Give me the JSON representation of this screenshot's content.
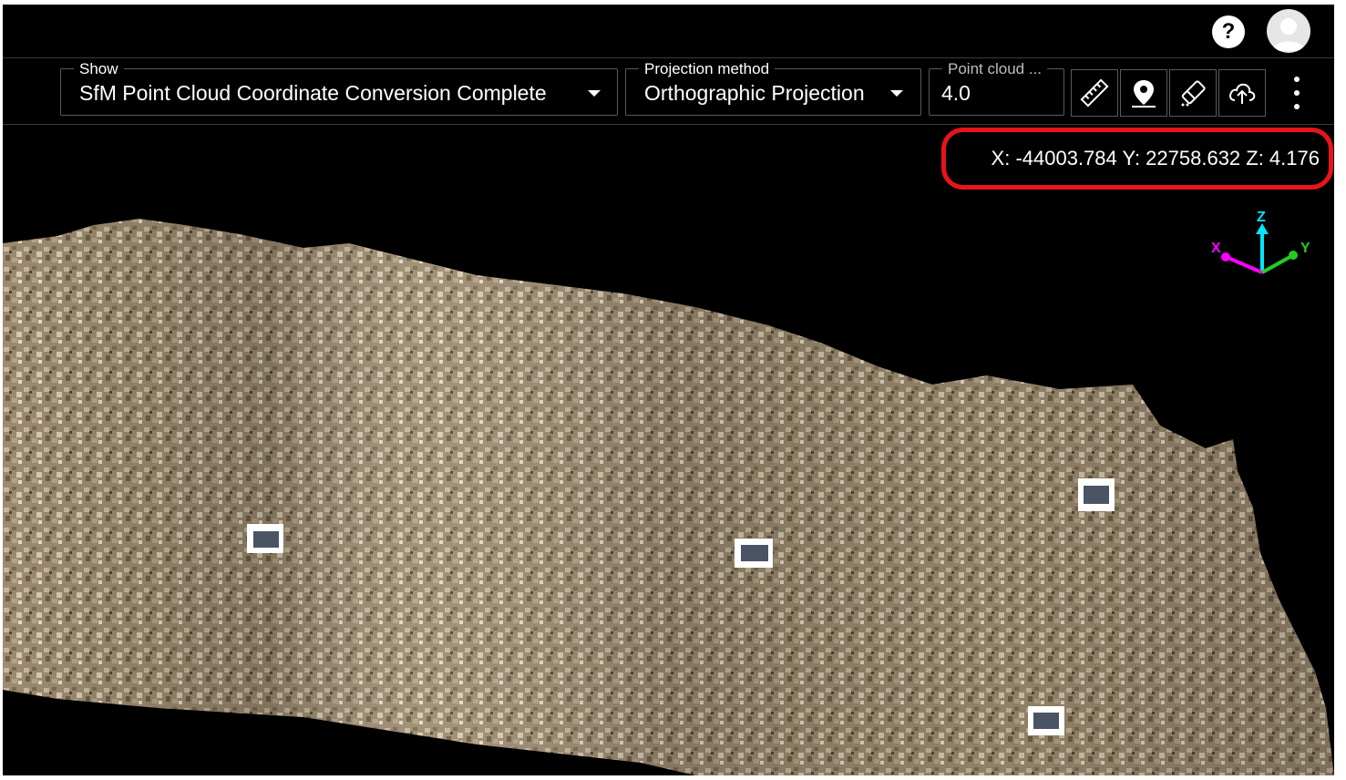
{
  "header": {
    "help_label": "?"
  },
  "toolbar": {
    "show": {
      "label": "Show",
      "value": "SfM Point Cloud Coordinate Conversion Complete"
    },
    "projection": {
      "label": "Projection method",
      "value": "Orthographic Projection"
    },
    "point_cloud": {
      "label": "Point cloud ...",
      "value": "4.0"
    }
  },
  "viewport": {
    "coordinates": "X: -44003.784 Y: 22758.632 Z: 4.176",
    "axes": {
      "x_label": "X",
      "y_label": "Y",
      "z_label": "Z",
      "x_color": "#ff00ff",
      "y_color": "#22cc22",
      "z_color": "#00e5ff"
    }
  },
  "colors": {
    "background": "#000000",
    "highlight": "#e8141b"
  }
}
